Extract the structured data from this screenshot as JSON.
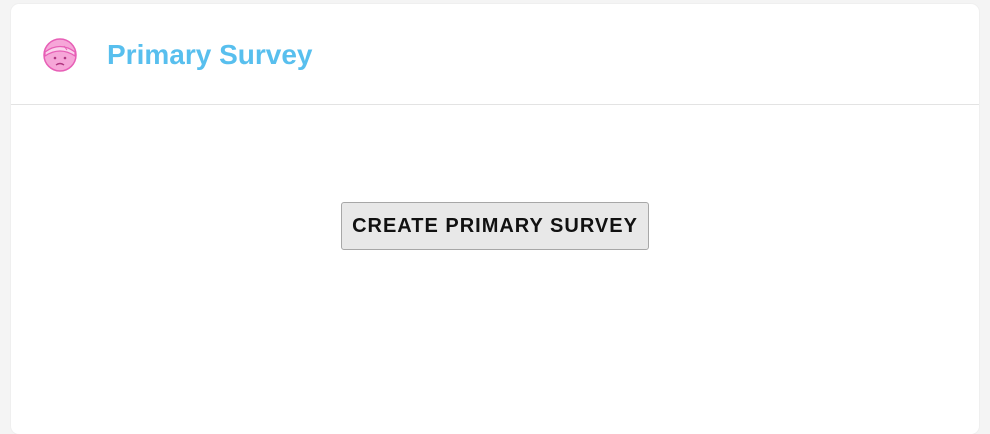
{
  "header": {
    "title": "Primary Survey",
    "icon": "injured-face-icon",
    "title_color": "#58bfee",
    "icon_color": "#f27ac6"
  },
  "main": {
    "create_button_label": "CREATE PRIMARY SURVEY"
  }
}
